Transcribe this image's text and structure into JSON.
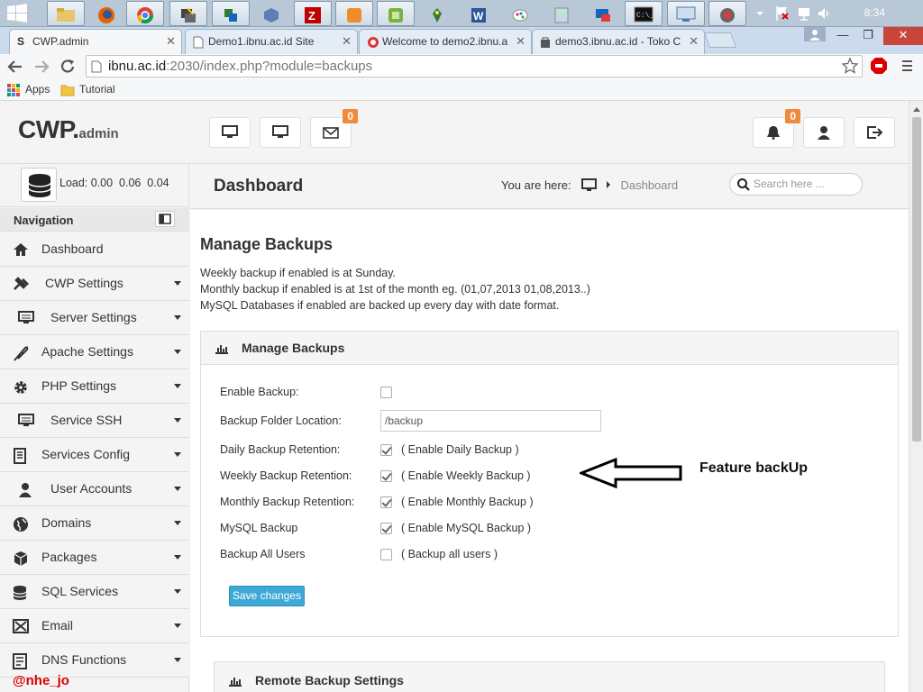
{
  "taskbar": {
    "clock": "8:34",
    "apps": [
      "file-explorer-icon",
      "firefox-icon",
      "chrome-icon",
      "putty-icon",
      "network-tool-icon",
      "virtualbox-icon",
      "filezilla-icon",
      "sublime-icon",
      "vmware-icon",
      "gps-icon",
      "word-icon",
      "paint-icon",
      "calculator-icon",
      "remote-icon",
      "cmd-icon",
      "monitor-icon",
      "recorder-icon"
    ]
  },
  "browser": {
    "tabs": [
      {
        "title": "CWP.admin",
        "active": true
      },
      {
        "title": "Demo1.ibnu.ac.id Site",
        "active": false
      },
      {
        "title": "Welcome to demo2.ibnu.a",
        "active": false
      },
      {
        "title": "demo3.ibnu.ac.id - Toko C",
        "active": false
      }
    ],
    "url_host": "ibnu.ac.id",
    "url_path": ":2030/index.php?module=backups",
    "bookmarks": {
      "apps": "Apps",
      "tutorial": "Tutorial"
    }
  },
  "header": {
    "logo_main": "CWP.",
    "logo_sub": "admin",
    "messages_badge": "0",
    "notifications_badge": "0"
  },
  "sidebar": {
    "load_text": "Load: 0.00  0.06  0.04",
    "nav_title": "Navigation",
    "items": [
      {
        "label": "Dashboard",
        "icon": "home-icon",
        "caret": false
      },
      {
        "label": "CWP Settings",
        "icon": "tools-icon",
        "caret": true
      },
      {
        "label": "Server Settings",
        "icon": "monitor-icon",
        "caret": true
      },
      {
        "label": "Apache Settings",
        "icon": "feather-icon",
        "caret": true
      },
      {
        "label": "PHP Settings",
        "icon": "gear-icon",
        "caret": true
      },
      {
        "label": "Service SSH",
        "icon": "monitor-icon",
        "caret": true
      },
      {
        "label": "Services Config",
        "icon": "document-icon",
        "caret": true
      },
      {
        "label": "User Accounts",
        "icon": "user-icon",
        "caret": true
      },
      {
        "label": "Domains",
        "icon": "globe-icon",
        "caret": true
      },
      {
        "label": "Packages",
        "icon": "cubes-icon",
        "caret": true
      },
      {
        "label": "SQL Services",
        "icon": "database-icon",
        "caret": true
      },
      {
        "label": "Email",
        "icon": "envelope-icon",
        "caret": true
      },
      {
        "label": "DNS Functions",
        "icon": "dns-icon",
        "caret": true
      }
    ]
  },
  "breadcrumb": {
    "page_title": "Dashboard",
    "prefix": "You are here:",
    "current": "Dashboard",
    "search_placeholder": "Search here ..."
  },
  "main": {
    "heading": "Manage Backups",
    "info": [
      "Weekly backup if enabled is at Sunday.",
      "Monthly backup if enabled is at 1st of the month eg. (01,07,2013 01,08,2013..)",
      "MySQL Databases if enabled are backed up every day with date format."
    ],
    "panel_title": "Manage Backups",
    "fields": {
      "enable_backup": {
        "label": "Enable Backup:",
        "checked": false
      },
      "folder": {
        "label": "Backup Folder Location:",
        "value": "/backup"
      },
      "daily": {
        "label": "Daily Backup Retention:",
        "text": "( Enable Daily Backup )",
        "checked": true
      },
      "weekly": {
        "label": "Weekly Backup Retention:",
        "text": "( Enable Weekly Backup )",
        "checked": true
      },
      "monthly": {
        "label": "Monthly Backup Retention:",
        "text": "( Enable Monthly Backup )",
        "checked": true
      },
      "mysql": {
        "label": "MySQL Backup",
        "text": "( Enable MySQL Backup )",
        "checked": true
      },
      "all_users": {
        "label": "Backup All Users",
        "text": "( Backup all users )",
        "checked": false
      }
    },
    "save_label": "Save changes",
    "annotation": "Feature backUp",
    "remote_title": "Remote Backup Settings"
  },
  "watermark": "@nhe_jo"
}
